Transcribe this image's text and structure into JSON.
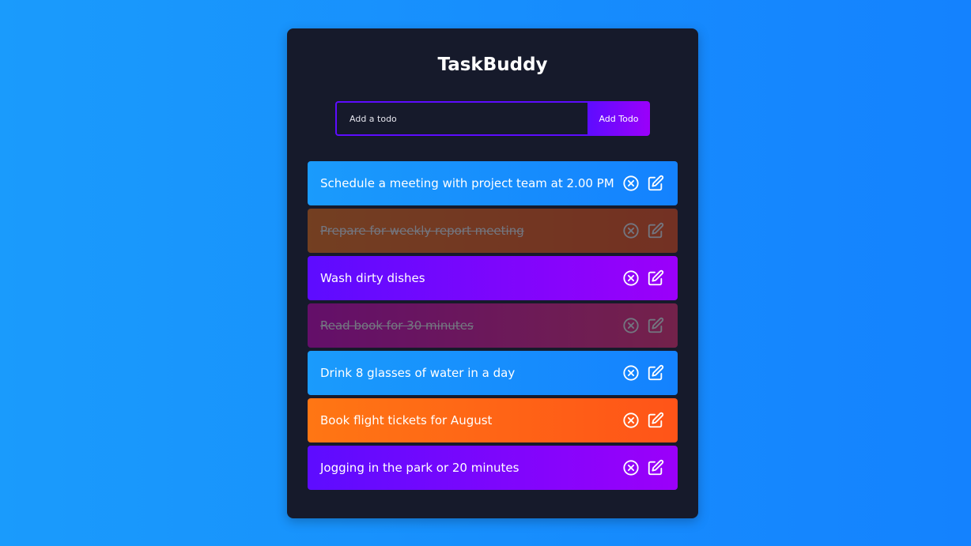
{
  "app": {
    "title": "TaskBuddy"
  },
  "form": {
    "placeholder": "Add a todo",
    "value": "",
    "button_label": "Add Todo"
  },
  "todos": [
    {
      "text": "Schedule a meeting with project team at 2.00 PM",
      "complete": false,
      "color": "blue"
    },
    {
      "text": "Prepare for weekly report meeting",
      "complete": true,
      "color": "orange"
    },
    {
      "text": "Wash dirty dishes",
      "complete": false,
      "color": "purple"
    },
    {
      "text": "Read book for 30 minutes",
      "complete": true,
      "color": "pink"
    },
    {
      "text": "Drink 8 glasses of water in a day",
      "complete": false,
      "color": "blue"
    },
    {
      "text": "Book flight tickets for August",
      "complete": false,
      "color": "orange"
    },
    {
      "text": "Jogging in the park or 20 minutes",
      "complete": false,
      "color": "purple"
    }
  ],
  "icons": {
    "delete": "close-circle-icon",
    "edit": "edit-icon"
  },
  "colors": {
    "background_start": "#1a9bfc",
    "background_end": "#1482fe",
    "panel": "#161a2b",
    "accent": "#5d0cff",
    "accent_end": "#9b00fa",
    "orange_start": "#ff7614",
    "orange_end": "#ff5418",
    "text": "#ffffff"
  }
}
